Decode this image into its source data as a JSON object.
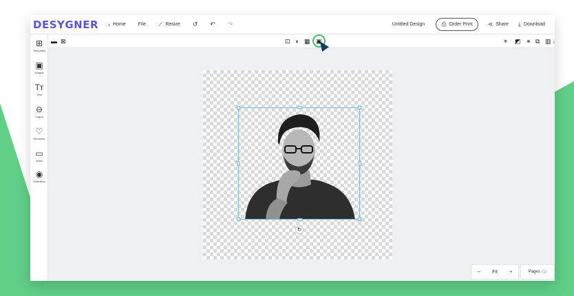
{
  "app": {
    "logo": "DESYGNER"
  },
  "topbar": {
    "home_label": "Home",
    "file_label": "File",
    "resize_label": "Resize",
    "doc_title": "Untitled Design",
    "order_print_label": "Order Print",
    "share_label": "Share",
    "download_label": "Download"
  },
  "sidebar": {
    "items": [
      {
        "label": "Templates",
        "icon": "grid-icon"
      },
      {
        "label": "Images",
        "icon": "image-icon"
      },
      {
        "label": "Text",
        "icon": "text-icon"
      },
      {
        "label": "Logos",
        "icon": "logo-icon"
      },
      {
        "label": "Elements",
        "icon": "heart-icon"
      },
      {
        "label": "Video",
        "icon": "video-icon"
      },
      {
        "label": "Animation",
        "icon": "animation-icon"
      }
    ]
  },
  "zoom": {
    "minus": "−",
    "level": "Fit",
    "plus": "+"
  },
  "pages": {
    "label": "Pages",
    "count": "(1)"
  }
}
